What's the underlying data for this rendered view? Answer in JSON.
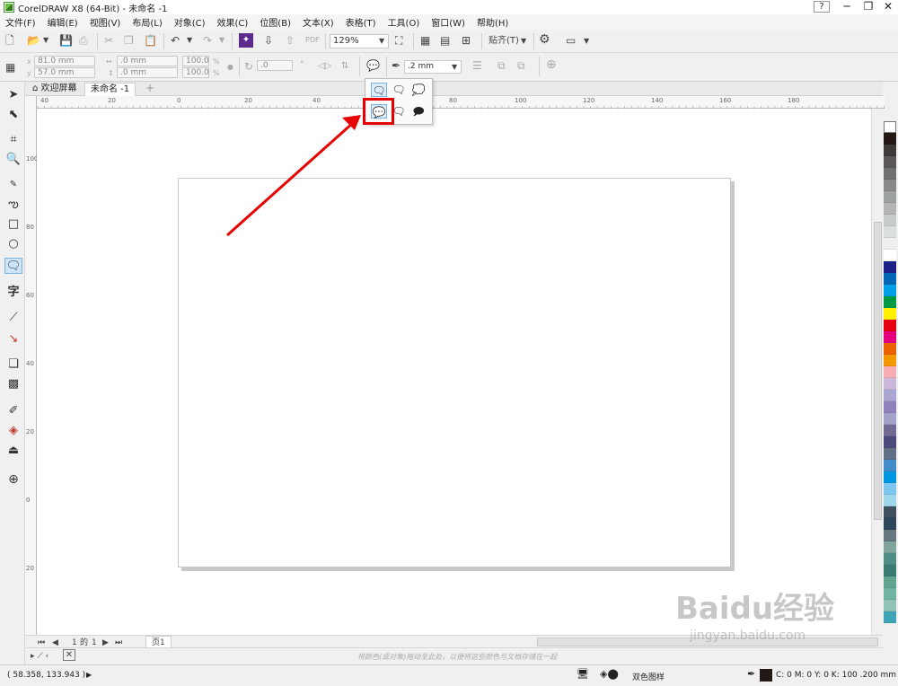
{
  "app": {
    "title": "CorelDRAW X8 (64-Bit) - 未命名 -1",
    "window_controls": {
      "help": "?",
      "minimize": "─",
      "restore": "❐",
      "close": "✕"
    }
  },
  "menu": [
    "文件(F)",
    "编辑(E)",
    "视图(V)",
    "布局(L)",
    "对象(C)",
    "效果(C)",
    "位图(B)",
    "文本(X)",
    "表格(T)",
    "工具(O)",
    "窗口(W)",
    "帮助(H)"
  ],
  "toolbar1": {
    "zoom": "129%",
    "snap_label": "贴齐(T)"
  },
  "toolbar2": {
    "x": "81.0 mm",
    "y": "57.0 mm",
    "w": ".0 mm",
    "h": ".0 mm",
    "scale_x": "100.0",
    "scale_y": "100.0",
    "pct": "%",
    "rotation": ".0",
    "deg": "°",
    "outline_width": ".2 mm"
  },
  "tabs": {
    "welcome": "欢迎屏幕",
    "doc": "未命名 -1",
    "add": "+"
  },
  "ruler": {
    "h_ticks": [
      "40",
      "20",
      "0",
      "20",
      "40",
      "60",
      "80",
      "100",
      "120",
      "140",
      "160",
      "180"
    ],
    "v_ticks": [
      "100",
      "80",
      "60",
      "40",
      "20",
      "0",
      "20",
      "40",
      "60",
      "80",
      "0"
    ],
    "unit": "毫米"
  },
  "pagebar": {
    "current": "1",
    "of": "的",
    "total": "1",
    "page_tab": "页1"
  },
  "docbar": {
    "hint": "将颜色(或对象)拖动至此处，以便将这些颜色与文档存储在一起"
  },
  "status": {
    "coords": "( 58.358, 133.943 )",
    "fill_label": "双色图样",
    "outline_info": "C: 0 M: 0 Y: 0 K: 100  .200 mm"
  },
  "watermark": {
    "brand": "Baidu经验",
    "url": "jingyan.baidu.com"
  },
  "colors": {
    "highlight": "#e60000",
    "palette": [
      "#ffffff",
      "#231815",
      "#3e3a39",
      "#595757",
      "#727171",
      "#898989",
      "#9fa0a0",
      "#b5b5b6",
      "#c9caca",
      "#dcdddd",
      "#efefef",
      "#ffffff",
      "#1d2088",
      "#0068b7",
      "#00a0e9",
      "#009944",
      "#fff100",
      "#e60012",
      "#e4007f",
      "#eb6100",
      "#f39800",
      "#f6aeb3",
      "#c9b8db",
      "#aaa4d1",
      "#8f82bc",
      "#a5a1c9",
      "#706a95",
      "#4c4a7a",
      "#5f6f86",
      "#418cc9",
      "#0097e0",
      "#7fc6ef",
      "#9fd6ec",
      "#3e4f5f",
      "#2d4659",
      "#66787f",
      "#7fa59c",
      "#4f8e85",
      "#3a7b72",
      "#5fa592",
      "#6fb4a3",
      "#90c2b5",
      "#3da5b7"
    ]
  }
}
